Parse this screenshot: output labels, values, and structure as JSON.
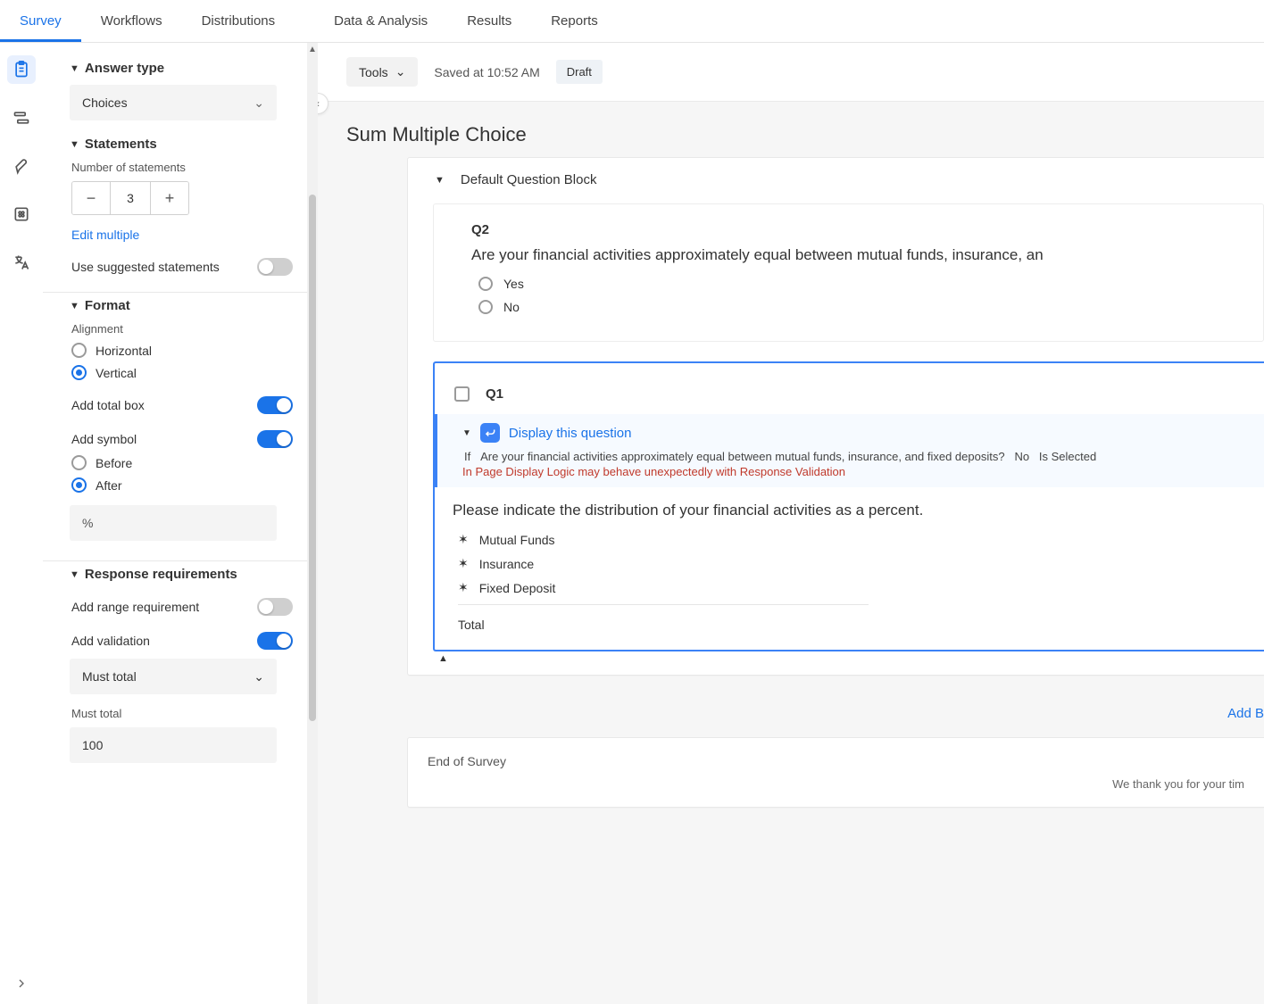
{
  "topnav": {
    "tabs": [
      "Survey",
      "Workflows",
      "Distributions",
      "Data & Analysis",
      "Results",
      "Reports"
    ],
    "active": 0
  },
  "iconrail": {
    "items": [
      {
        "name": "survey-builder-icon",
        "active": true
      },
      {
        "name": "flow-icon",
        "active": false
      },
      {
        "name": "look-feel-icon",
        "active": false
      },
      {
        "name": "options-icon",
        "active": false
      },
      {
        "name": "translations-icon",
        "active": false
      }
    ]
  },
  "sidebar": {
    "answer_type": {
      "heading": "Answer type",
      "dropdown": "Choices"
    },
    "statements": {
      "heading": "Statements",
      "number_label": "Number of statements",
      "count": "3",
      "edit_multiple": "Edit multiple",
      "suggested_label": "Use suggested statements",
      "suggested_on": false
    },
    "format": {
      "heading": "Format",
      "alignment_label": "Alignment",
      "alignment_options": [
        "Horizontal",
        "Vertical"
      ],
      "alignment_selected": "Vertical",
      "add_total_label": "Add total box",
      "add_total_on": true,
      "add_symbol_label": "Add symbol",
      "add_symbol_on": true,
      "symbol_position_options": [
        "Before",
        "After"
      ],
      "symbol_position_selected": "After",
      "symbol_value": "%"
    },
    "response": {
      "heading": "Response requirements",
      "add_range_label": "Add range requirement",
      "add_range_on": false,
      "add_validation_label": "Add validation",
      "add_validation_on": true,
      "validation_dropdown": "Must total",
      "must_total_label": "Must total",
      "must_total_value": "100"
    }
  },
  "toolbar": {
    "tools_label": "Tools",
    "saved_label": "Saved at 10:52 AM",
    "draft_label": "Draft"
  },
  "canvas": {
    "page_title": "Sum Multiple Choice",
    "block": {
      "name": "Default Question Block"
    },
    "q2": {
      "num": "Q2",
      "text": "Are your financial activities approximately equal between mutual funds, insurance, an",
      "choices": [
        "Yes",
        "No"
      ]
    },
    "q1": {
      "num": "Q1",
      "logic_title": "Display this question",
      "logic_if_prefix": "If",
      "logic_if_body": "Are your financial activities approximately equal between mutual funds, insurance, and fixed deposits?",
      "logic_if_answer": "No",
      "logic_if_suffix": "Is Selected",
      "logic_warn": "In Page Display Logic may behave unexpectedly with Response Validation",
      "text": "Please indicate the distribution of your financial activities as a percent.",
      "statements": [
        "Mutual Funds",
        "Insurance",
        "Fixed Deposit"
      ],
      "total_label": "Total"
    },
    "add_block": "Add B",
    "end_block": {
      "title": "End of Survey",
      "thanks": "We thank you for your tim"
    }
  }
}
